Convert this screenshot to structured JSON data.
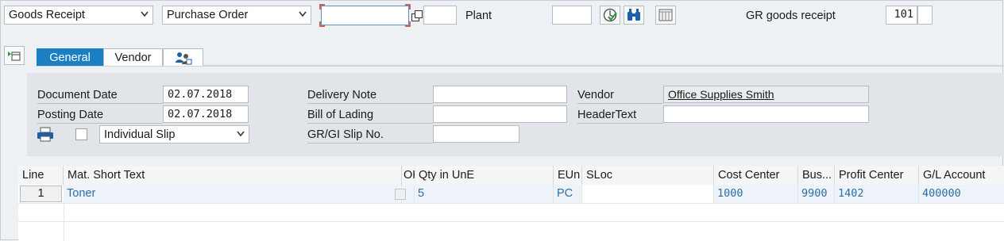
{
  "toolbar": {
    "transaction": "Goods Receipt",
    "reference_doc": "Purchase Order",
    "po_number": "",
    "po_item": "",
    "plant_label": "Plant",
    "plant_value": "",
    "movement_label": "GR goods receipt",
    "movement_type": "101",
    "movement_extra": ""
  },
  "tabs": [
    {
      "label": "General",
      "active": true
    },
    {
      "label": "Vendor",
      "active": false
    },
    {
      "label": "",
      "icon": "partner-icon",
      "active": false
    }
  ],
  "header": {
    "document_date_label": "Document Date",
    "document_date": "02.07.2018",
    "posting_date_label": "Posting Date",
    "posting_date": "02.07.2018",
    "print_checked": false,
    "slip_type": "Individual Slip",
    "delivery_note_label": "Delivery Note",
    "delivery_note": "",
    "bill_of_lading_label": "Bill of Lading",
    "bill_of_lading": "",
    "grgi_slip_label": "GR/GI Slip No.",
    "grgi_slip": "",
    "vendor_label": "Vendor",
    "vendor_value": "Office Supplies Smith",
    "header_text_label": "HeaderText",
    "header_text": ""
  },
  "items_table": {
    "columns": [
      "Line",
      "Mat. Short Text",
      "OK",
      "Qty in UnE",
      "EUn",
      "SLoc",
      "Cost Center",
      "Bus...",
      "Profit Center",
      "G/L Account"
    ],
    "rows": [
      {
        "line": "1",
        "mat_short_text": "Toner",
        "ok": false,
        "qty": "5",
        "eun": "PC",
        "sloc": "",
        "cost_center": "1000",
        "business_area": "9900",
        "profit_center": "1402",
        "gl_account": "400000"
      }
    ]
  },
  "icons": {
    "multi_select": "copy-icon",
    "execute": "execute-check-icon",
    "find": "binoculars-icon",
    "layout": "table-layout-icon",
    "detail": "detail-expand-icon",
    "print": "printer-icon"
  },
  "colors": {
    "accent": "#1b7fc4",
    "panel": "#e1e5e9",
    "background": "#eef1f3",
    "cell_value": "#2b6ea8",
    "focus_border": "#c0392b"
  }
}
